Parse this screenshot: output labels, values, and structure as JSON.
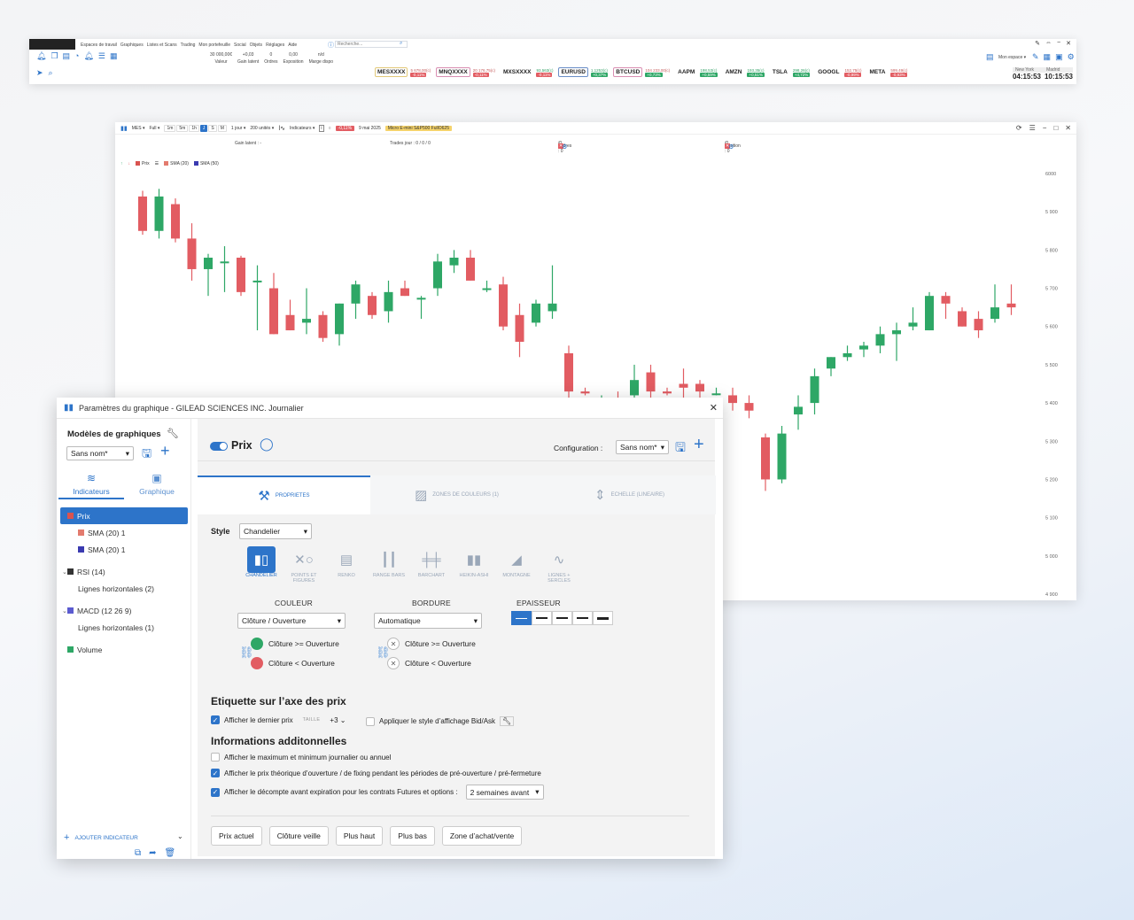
{
  "topbar": {
    "menu": [
      "Espaces de travail",
      "Graphiques",
      "Listes et Scans",
      "Trading",
      "Mon portefeuille",
      "Social",
      "Objets",
      "Réglages",
      "Aide"
    ],
    "search_placeholder": "Recherche...",
    "stats": [
      {
        "value": "30 000,00€",
        "label": "Valeur"
      },
      {
        "value": "+0,03",
        "label": "Gain latent"
      },
      {
        "value": "0",
        "label": "Ordres"
      },
      {
        "value": "0,00",
        "label": "Exposition"
      },
      {
        "value": "n/d",
        "label": "Marge dispo"
      }
    ],
    "workspace_label": "Mon espace",
    "tickers": [
      {
        "symbol": "MESXXXX",
        "price": "5 678,00(c)",
        "change": "-0,11%",
        "up": false,
        "style": "gold"
      },
      {
        "symbol": "MNQXXXX",
        "price": "20 176,75(c)",
        "change": "-0,11%",
        "up": false,
        "style": "pink"
      },
      {
        "symbol": "MXSXXXX",
        "price": "93,563(c)",
        "change": "-0,11%",
        "up": true,
        "style": "plain"
      },
      {
        "symbol": "EURUSD",
        "price": "1,1253(c)",
        "change": "+0,37%",
        "up": true,
        "style": "blue"
      },
      {
        "symbol": "BTCUSD",
        "price": "104 233,00(c)",
        "change": "+0,73%",
        "up": false,
        "style": "pink"
      },
      {
        "symbol": "AAPM",
        "price": "198,53(c)",
        "change": "+0,59%",
        "up": true,
        "style": "plain"
      },
      {
        "symbol": "AMZN",
        "price": "193,35(c)",
        "change": "+0,51%",
        "up": true,
        "style": "plain"
      },
      {
        "symbol": "TSLA",
        "price": "298,26(c)",
        "change": "+4,72%",
        "up": true,
        "style": "plain"
      },
      {
        "symbol": "GOOGL",
        "price": "152,75(c)",
        "change": "-0,99%",
        "up": false,
        "style": "plain"
      },
      {
        "symbol": "META",
        "price": "599,49(c)",
        "change": "-0,93%",
        "up": false,
        "style": "plain"
      }
    ],
    "clocks": {
      "city1": "New York",
      "city2": "Madrid",
      "time1": "04:15:53",
      "time2": "10:15:53"
    }
  },
  "chartwin": {
    "symbol": "MES",
    "mode": "Full",
    "timeframes": [
      "1m",
      "5m",
      "1h",
      "J",
      "S",
      "M"
    ],
    "active_timeframe": "J",
    "period": "1 jour",
    "units": "200 unités",
    "indicators_label": "Indicateurs",
    "change": "-0,11%",
    "date": "9 mai 2025",
    "contract": "Micro E-mini S&P500 FullO625",
    "status": {
      "gain": "Gain latent : -",
      "trades": "Trades jour : 0 / 0 / 0",
      "orders": "Ordres : 0",
      "position": "Position : 0"
    },
    "legend": {
      "price": "Prix",
      "sma1": "SMA (20)",
      "sma2": "SMA (50)"
    }
  },
  "chart_data": {
    "type": "candlestick",
    "y_ticks": [
      "6000",
      "5 900",
      "5 800",
      "5 700",
      "5 600",
      "5 500",
      "5 400",
      "5 300",
      "5 200",
      "5 100",
      "5 000",
      "4 900"
    ],
    "ylim": [
      4900,
      6000
    ],
    "up_color": "#2ea766",
    "down_color": "#e25c62",
    "candles": [
      {
        "o": 5940,
        "h": 5955,
        "l": 5840,
        "c": 5850
      },
      {
        "o": 5850,
        "h": 5960,
        "l": 5830,
        "c": 5940
      },
      {
        "o": 5920,
        "h": 5935,
        "l": 5820,
        "c": 5830
      },
      {
        "o": 5830,
        "h": 5870,
        "l": 5720,
        "c": 5750
      },
      {
        "o": 5750,
        "h": 5790,
        "l": 5680,
        "c": 5780
      },
      {
        "o": 5770,
        "h": 5810,
        "l": 5690,
        "c": 5770
      },
      {
        "o": 5780,
        "h": 5785,
        "l": 5680,
        "c": 5690
      },
      {
        "o": 5720,
        "h": 5760,
        "l": 5590,
        "c": 5720
      },
      {
        "o": 5700,
        "h": 5740,
        "l": 5580,
        "c": 5580
      },
      {
        "o": 5630,
        "h": 5670,
        "l": 5590,
        "c": 5590
      },
      {
        "o": 5610,
        "h": 5700,
        "l": 5580,
        "c": 5620
      },
      {
        "o": 5630,
        "h": 5640,
        "l": 5560,
        "c": 5570
      },
      {
        "o": 5580,
        "h": 5660,
        "l": 5550,
        "c": 5660
      },
      {
        "o": 5660,
        "h": 5720,
        "l": 5620,
        "c": 5710
      },
      {
        "o": 5680,
        "h": 5690,
        "l": 5620,
        "c": 5630
      },
      {
        "o": 5640,
        "h": 5720,
        "l": 5610,
        "c": 5690
      },
      {
        "o": 5700,
        "h": 5720,
        "l": 5680,
        "c": 5680
      },
      {
        "o": 5675,
        "h": 5680,
        "l": 5620,
        "c": 5675
      },
      {
        "o": 5700,
        "h": 5790,
        "l": 5680,
        "c": 5770
      },
      {
        "o": 5760,
        "h": 5800,
        "l": 5740,
        "c": 5780
      },
      {
        "o": 5780,
        "h": 5800,
        "l": 5720,
        "c": 5720
      },
      {
        "o": 5700,
        "h": 5720,
        "l": 5690,
        "c": 5700
      },
      {
        "o": 5710,
        "h": 5730,
        "l": 5590,
        "c": 5600
      },
      {
        "o": 5630,
        "h": 5660,
        "l": 5520,
        "c": 5560
      },
      {
        "o": 5610,
        "h": 5670,
        "l": 5600,
        "c": 5660
      },
      {
        "o": 5640,
        "h": 5760,
        "l": 5620,
        "c": 5660
      },
      {
        "o": 5530,
        "h": 5550,
        "l": 5410,
        "c": 5430
      },
      {
        "o": 5430,
        "h": 5440,
        "l": 5420,
        "c": 5425
      },
      {
        "o": 5400,
        "h": 5420,
        "l": 5390,
        "c": 5400
      },
      {
        "o": 5410,
        "h": 5430,
        "l": 5380,
        "c": 5400
      },
      {
        "o": 5420,
        "h": 5500,
        "l": 5390,
        "c": 5460
      },
      {
        "o": 5480,
        "h": 5500,
        "l": 5400,
        "c": 5430
      },
      {
        "o": 5430,
        "h": 5440,
        "l": 5420,
        "c": 5425
      },
      {
        "o": 5450,
        "h": 5490,
        "l": 5410,
        "c": 5440
      },
      {
        "o": 5450,
        "h": 5460,
        "l": 5390,
        "c": 5430
      },
      {
        "o": 5425,
        "h": 5440,
        "l": 5420,
        "c": 5425
      },
      {
        "o": 5420,
        "h": 5440,
        "l": 5380,
        "c": 5400
      },
      {
        "o": 5400,
        "h": 5420,
        "l": 5360,
        "c": 5380
      },
      {
        "o": 5310,
        "h": 5320,
        "l": 5170,
        "c": 5200
      },
      {
        "o": 5200,
        "h": 5340,
        "l": 5190,
        "c": 5320
      },
      {
        "o": 5370,
        "h": 5420,
        "l": 5330,
        "c": 5390
      },
      {
        "o": 5400,
        "h": 5490,
        "l": 5370,
        "c": 5470
      },
      {
        "o": 5490,
        "h": 5520,
        "l": 5470,
        "c": 5520
      },
      {
        "o": 5520,
        "h": 5550,
        "l": 5510,
        "c": 5530
      },
      {
        "o": 5540,
        "h": 5560,
        "l": 5520,
        "c": 5550
      },
      {
        "o": 5550,
        "h": 5600,
        "l": 5530,
        "c": 5580
      },
      {
        "o": 5580,
        "h": 5610,
        "l": 5510,
        "c": 5590
      },
      {
        "o": 5600,
        "h": 5650,
        "l": 5590,
        "c": 5610
      },
      {
        "o": 5590,
        "h": 5690,
        "l": 5590,
        "c": 5680
      },
      {
        "o": 5680,
        "h": 5690,
        "l": 5620,
        "c": 5660
      },
      {
        "o": 5640,
        "h": 5650,
        "l": 5600,
        "c": 5600
      },
      {
        "o": 5620,
        "h": 5640,
        "l": 5570,
        "c": 5590
      },
      {
        "o": 5620,
        "h": 5710,
        "l": 5610,
        "c": 5650
      },
      {
        "o": 5660,
        "h": 5710,
        "l": 5630,
        "c": 5650
      }
    ]
  },
  "dialog": {
    "title": "Paramètres du graphique - GILEAD SCIENCES INC. Journalier",
    "models_title": "Modèles de graphiques",
    "model_value": "Sans nom*",
    "tab_indicators": "Indicateurs",
    "tab_chart": "Graphique",
    "tree": [
      {
        "label": "Prix",
        "color": "#d9534f",
        "level": 0,
        "selected": true
      },
      {
        "label": "SMA (20) 1",
        "color": "#e37b6e",
        "level": 1
      },
      {
        "label": "SMA (20) 1",
        "color": "#3a3ab0",
        "level": 1
      },
      {
        "gap": true
      },
      {
        "label": "RSI (14)",
        "color": "#333333",
        "level": 0,
        "expand": true
      },
      {
        "label": "Lignes horizontales (2)",
        "level": 1,
        "nosw": true
      },
      {
        "gap": true
      },
      {
        "label": "MACD (12 26 9)",
        "color": "#5b5bd0",
        "level": 0,
        "expand": true
      },
      {
        "label": "Lignes horizontales (1)",
        "level": 1,
        "nosw": true
      },
      {
        "gap": true
      },
      {
        "label": "Volume",
        "color": "#2ea766",
        "level": 0
      }
    ],
    "add_indicator": "AJOUTER INDICATEUR",
    "main": {
      "title": "Prix",
      "config_label": "Configuration :",
      "config_value": "Sans nom*",
      "tabs": [
        "PROPRIETES",
        "ZONES DE COULEURS (1)",
        "ECHELLE (LINEAIRE)"
      ],
      "style_label": "Style",
      "style_value": "Chandelier",
      "styles": [
        "CHANDELIER",
        "POINTS ET FIGURES",
        "RENKO",
        "RANGE BARS",
        "BARCHART",
        "HEIKIN-ASHI",
        "MONTAGNE",
        "LIGNES + SERCLES"
      ],
      "col_color": "COULEUR",
      "col_border": "BORDURE",
      "col_thickness": "EPAISSEUR",
      "color_select": "Clôture / Ouverture",
      "border_select": "Automatique",
      "cond_up": "Clôture >= Ouverture",
      "cond_down": "Clôture < Ouverture",
      "label_section": "Etiquette sur l’axe des prix",
      "show_last": "Afficher le dernier prix",
      "size_cap": "TAILLE",
      "size_val": "+3",
      "bidask": "Appliquer le style d’affichage Bid/Ask",
      "info_section": "Informations additonnelles",
      "opt1": "Afficher le maximum et minimum journalier ou annuel",
      "opt2": "Afficher le prix théorique d’ouverture / de fixing pendant les périodes de pré-ouverture / pré-fermeture",
      "opt3": "Afficher le décompte avant expiration pour les contrats Futures et options :",
      "opt3_select": "2 semaines avant",
      "buttons": [
        "Prix actuel",
        "Clôture veille",
        "Plus haut",
        "Plus bas",
        "Zone d’achat/vente"
      ]
    }
  }
}
